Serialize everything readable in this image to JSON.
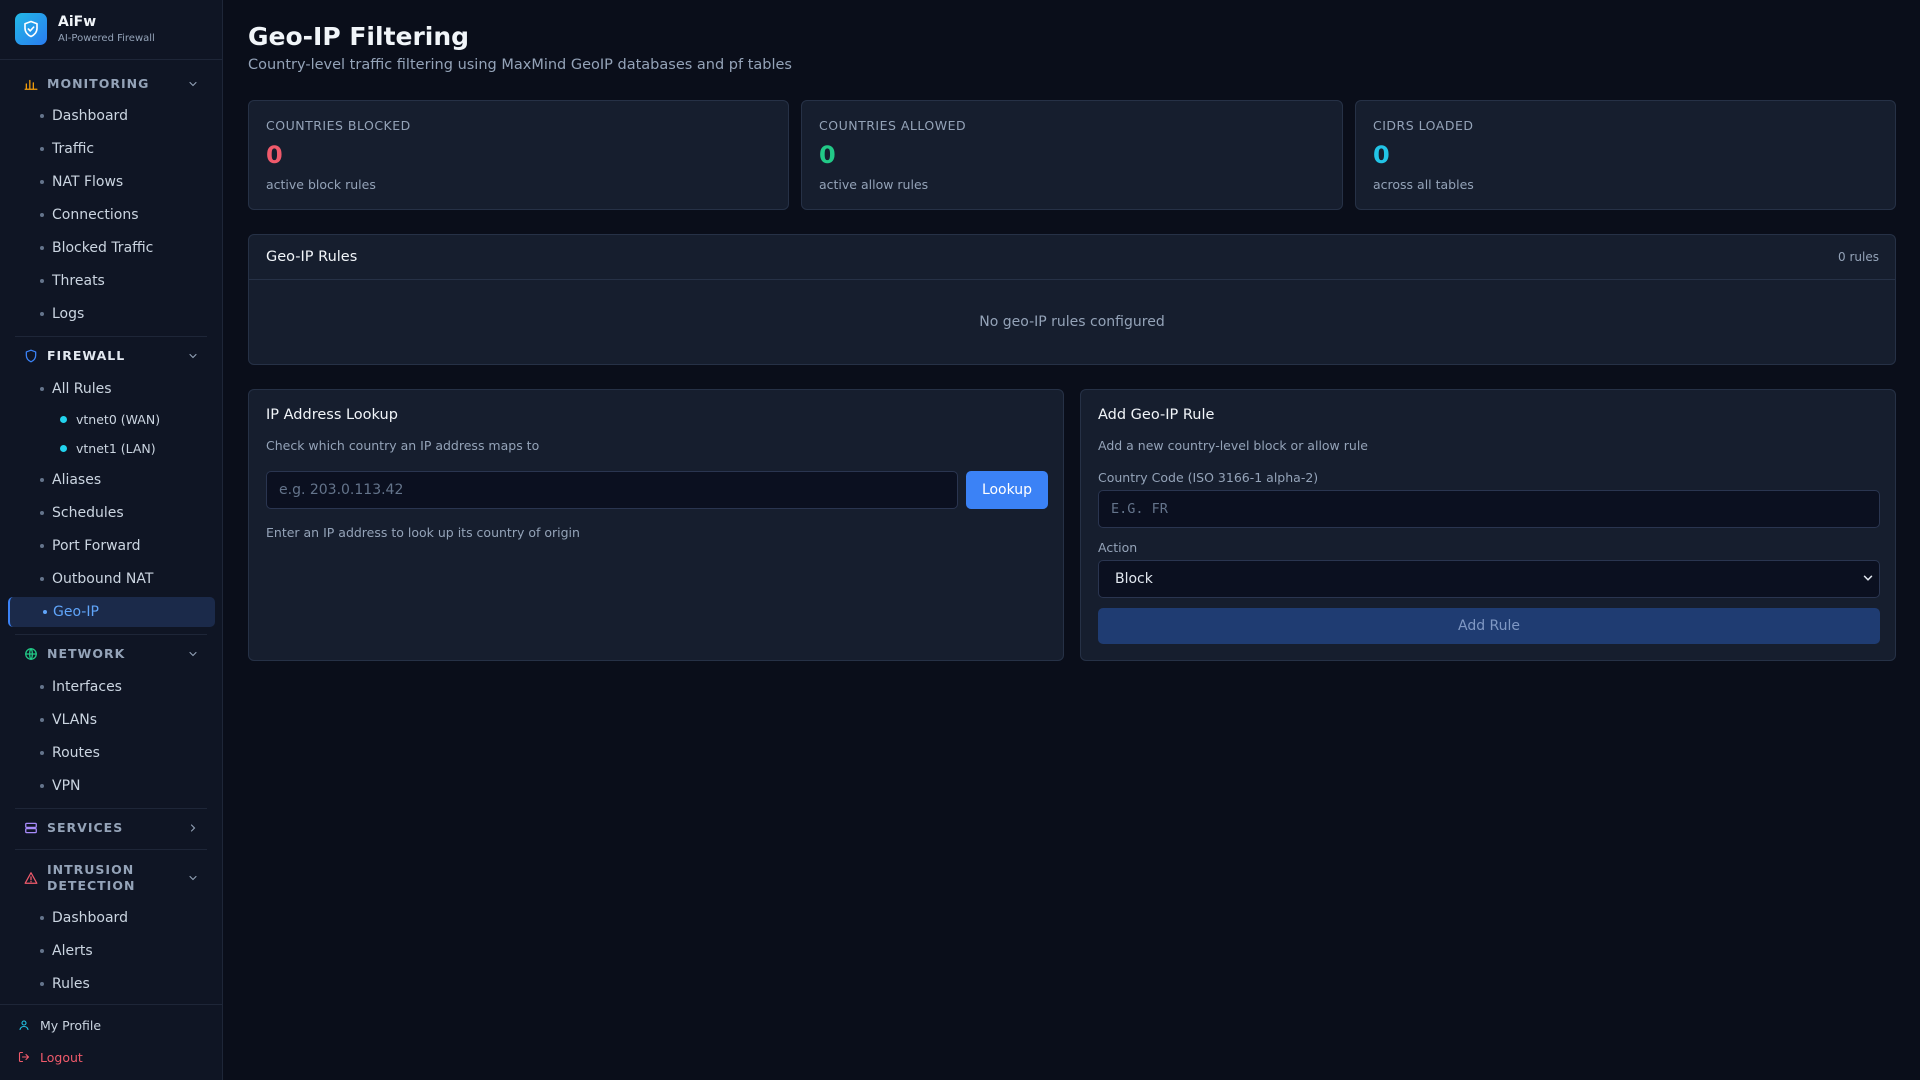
{
  "brand": {
    "name": "AiFw",
    "subtitle": "AI-Powered Firewall"
  },
  "sidebar": {
    "monitoring": {
      "label": "MONITORING",
      "items": [
        "Dashboard",
        "Traffic",
        "NAT Flows",
        "Connections",
        "Blocked Traffic",
        "Threats",
        "Logs"
      ]
    },
    "firewall": {
      "label": "FIREWALL",
      "items": [
        "All Rules",
        "Aliases",
        "Schedules",
        "Port Forward",
        "Outbound NAT",
        "Geo-IP"
      ],
      "sub_items": [
        "vtnet0 (WAN)",
        "vtnet1 (LAN)"
      ],
      "active": "Geo-IP"
    },
    "network": {
      "label": "NETWORK",
      "items": [
        "Interfaces",
        "VLANs",
        "Routes",
        "VPN"
      ]
    },
    "services": {
      "label": "SERVICES"
    },
    "intrusion": {
      "label_line1": "INTRUSION",
      "label_line2": "DETECTION",
      "items": [
        "Dashboard",
        "Alerts",
        "Rules"
      ]
    },
    "footer": {
      "profile": "My Profile",
      "logout": "Logout"
    }
  },
  "page": {
    "title": "Geo-IP Filtering",
    "subtitle": "Country-level traffic filtering using MaxMind GeoIP databases and pf tables"
  },
  "stats": [
    {
      "label": "COUNTRIES BLOCKED",
      "value": "0",
      "desc": "active block rules",
      "color": "#f05a6b"
    },
    {
      "label": "COUNTRIES ALLOWED",
      "value": "0",
      "desc": "active allow rules",
      "color": "#22c987"
    },
    {
      "label": "CIDRS LOADED",
      "value": "0",
      "desc": "across all tables",
      "color": "#22c4e6"
    }
  ],
  "rules_panel": {
    "title": "Geo-IP Rules",
    "count": "0 rules",
    "empty": "No geo-IP rules configured"
  },
  "lookup": {
    "title": "IP Address Lookup",
    "desc": "Check which country an IP address maps to",
    "placeholder": "e.g. 203.0.113.42",
    "button": "Lookup",
    "hint": "Enter an IP address to look up its country of origin"
  },
  "add_rule": {
    "title": "Add Geo-IP Rule",
    "desc": "Add a new country-level block or allow rule",
    "country_label": "Country Code (ISO 3166-1 alpha-2)",
    "country_placeholder": "E.G. FR",
    "action_label": "Action",
    "action_value": "Block",
    "button": "Add Rule"
  },
  "colors": {
    "accent": "#3b82f6",
    "background": "#0a0e1a",
    "card": "#161e2e"
  }
}
